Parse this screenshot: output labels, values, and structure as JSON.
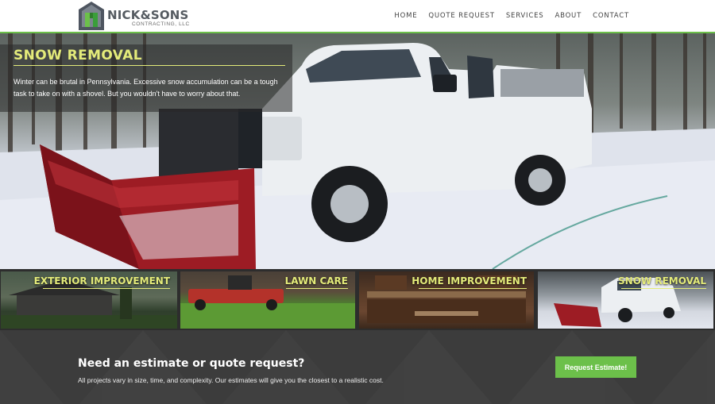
{
  "header": {
    "logo": {
      "name": "NICK&SONS",
      "subtitle": "CONTRACTING, LLC"
    },
    "nav": [
      "HOME",
      "QUOTE REQUEST",
      "SERVICES",
      "ABOUT",
      "CONTACT"
    ]
  },
  "hero": {
    "title": "SNOW REMOVAL",
    "text": "Winter can be brutal in Pennsylvania. Excessive snow accumulation can be a tough task to take on with a shovel. But you wouldn't have to worry about that."
  },
  "services": [
    {
      "label": "EXTERIOR IMPROVEMENT"
    },
    {
      "label": "LAWN CARE"
    },
    {
      "label": "HOME IMPROVEMENT"
    },
    {
      "label": "SNOW REMOVAL"
    }
  ],
  "cta": {
    "title": "Need an estimate or quote request?",
    "subtitle": "All projects vary in size, time, and complexity. Our estimates will give you the closest to a realistic cost.",
    "button": "Request Estimate!"
  },
  "colors": {
    "accent_green": "#6cc04a",
    "title_yellow": "#e4eb7a",
    "dark_bg": "#3c3c3c"
  }
}
